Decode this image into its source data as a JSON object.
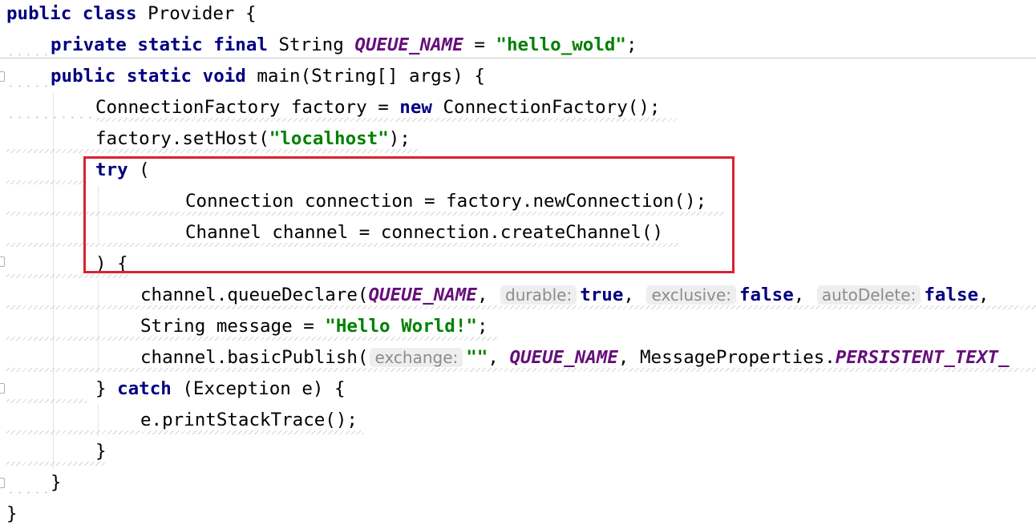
{
  "editor": {
    "lines": [
      {
        "parts": [
          "public",
          " ",
          "class",
          " Provider {"
        ]
      },
      {
        "parts": [
          "private",
          " ",
          "static",
          " ",
          "final",
          " String ",
          "QUEUE_NAME",
          " = ",
          "\"hello_wold\"",
          ";"
        ]
      },
      {
        "parts": [
          "public",
          " ",
          "static",
          " ",
          "void",
          " main(String[] args) {"
        ]
      },
      {
        "parts": [
          "ConnectionFactory factory = ",
          "new",
          " ConnectionFactory();"
        ]
      },
      {
        "parts": [
          "factory.setHost(",
          "\"localhost\"",
          ");"
        ]
      },
      {
        "parts": [
          "try",
          " ("
        ]
      },
      {
        "parts": [
          "Connection connection = factory.newConnection();"
        ]
      },
      {
        "parts": [
          "Channel channel = connection.createChannel()"
        ]
      },
      {
        "parts": [
          ") {"
        ]
      },
      {
        "parts": [
          "channel.queueDeclare(",
          "QUEUE_NAME",
          ", ",
          "durable:",
          "true",
          ", ",
          "exclusive:",
          "false",
          ", ",
          "autoDelete:",
          "false",
          ","
        ]
      },
      {
        "parts": [
          "String message = ",
          "\"Hello World!\"",
          ";"
        ]
      },
      {
        "parts": [
          "channel.basicPublish(",
          "exchange:",
          "\"\"",
          ", ",
          "QUEUE_NAME",
          ", MessageProperties.",
          "PERSISTENT_TEXT_"
        ]
      },
      {
        "parts": [
          "} ",
          "catch",
          " (Exception e) {"
        ]
      },
      {
        "parts": [
          "e.printStackTrace();"
        ]
      },
      {
        "parts": [
          "}"
        ]
      },
      {
        "parts": [
          "}"
        ]
      },
      {
        "parts": [
          "}"
        ]
      }
    ]
  },
  "colors": {
    "keyword": "#000080",
    "string": "#008000",
    "constant": "#660e7a",
    "hint_text": "#8c8c8c",
    "hint_bg": "#eeeeee",
    "highlight_border": "#d9232f"
  }
}
